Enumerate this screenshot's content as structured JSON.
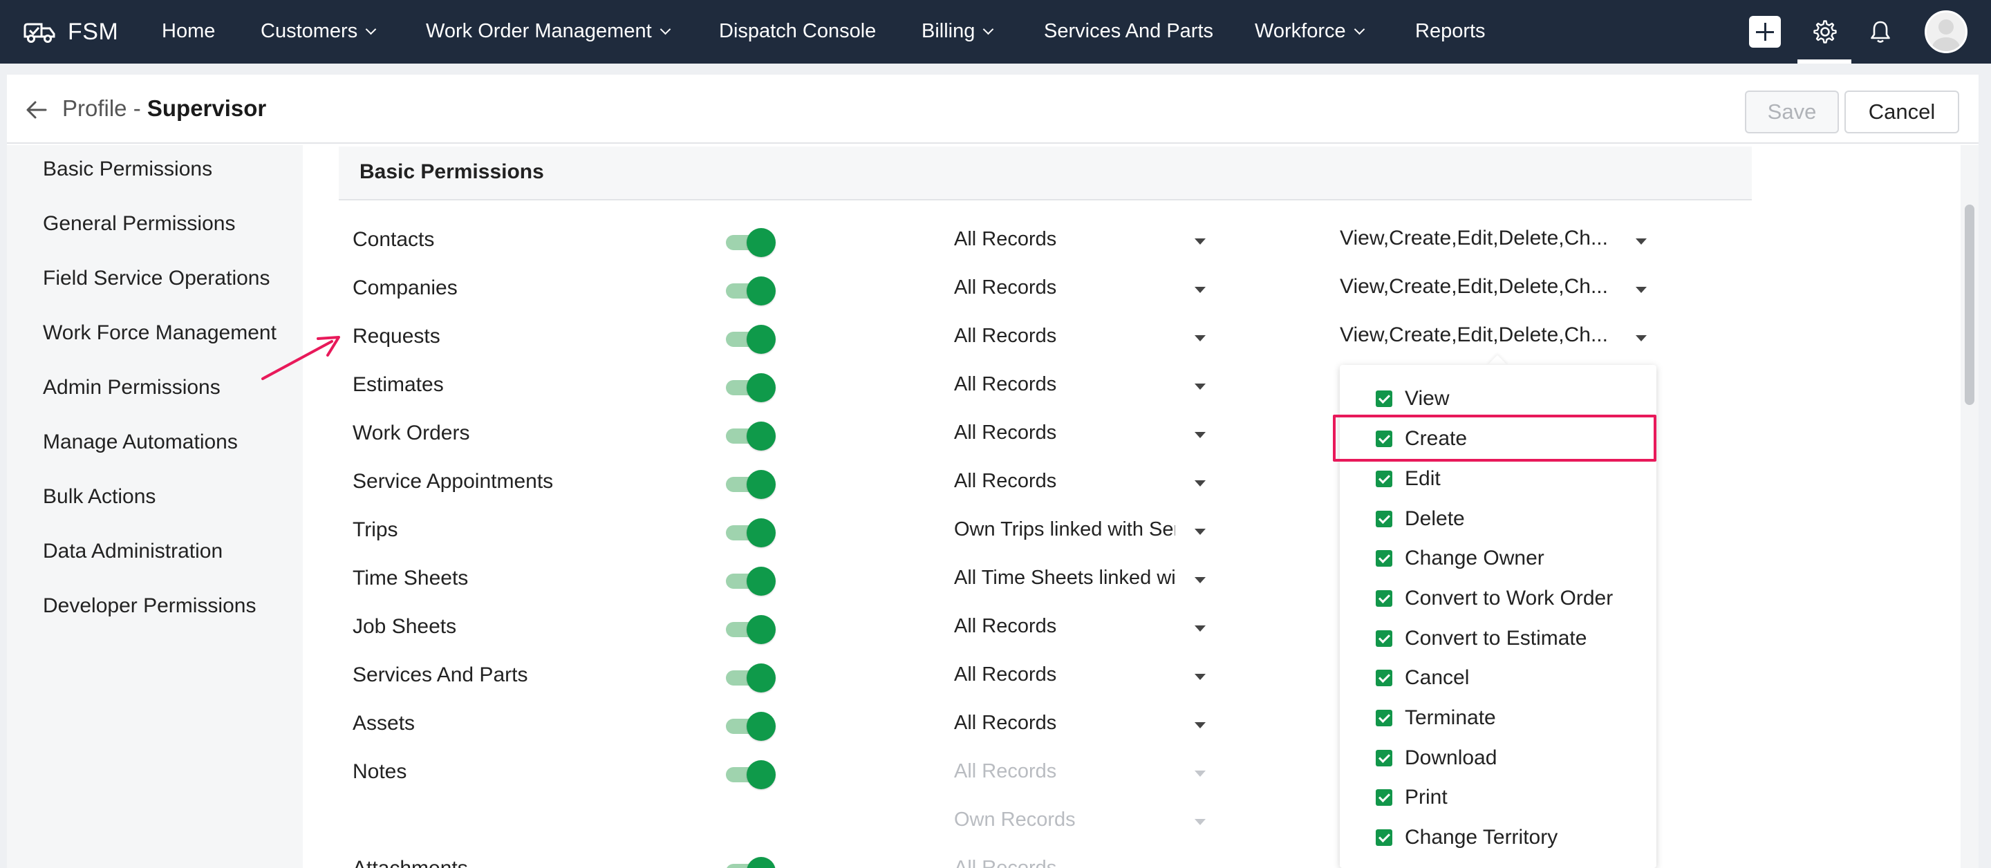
{
  "app": {
    "name": "FSM"
  },
  "nav": {
    "items": [
      {
        "label": "Home",
        "dropdown": false
      },
      {
        "label": "Customers",
        "dropdown": true
      },
      {
        "label": "Work Order Management",
        "dropdown": true
      },
      {
        "label": "Dispatch Console",
        "dropdown": false
      },
      {
        "label": "Billing",
        "dropdown": true
      },
      {
        "label": "Services And Parts",
        "dropdown": false
      },
      {
        "label": "Workforce",
        "dropdown": true
      },
      {
        "label": "Reports",
        "dropdown": false
      }
    ],
    "icons": [
      "plus-icon",
      "gear-icon",
      "bell-icon",
      "user-avatar"
    ]
  },
  "header": {
    "prefix": "Profile - ",
    "title": "Supervisor",
    "save_label": "Save",
    "cancel_label": "Cancel"
  },
  "sidebar": {
    "items": [
      "Basic Permissions",
      "General Permissions",
      "Field Service Operations",
      "Work Force Management",
      "Admin Permissions",
      "Manage Automations",
      "Bulk Actions",
      "Data Administration",
      "Developer Permissions"
    ]
  },
  "section": {
    "title": "Basic Permissions"
  },
  "rows": [
    {
      "label": "Contacts",
      "enabled": true,
      "scope": "All Records",
      "permissions": "View,Create,Edit,Delete,Ch..."
    },
    {
      "label": "Companies",
      "enabled": true,
      "scope": "All Records",
      "permissions": "View,Create,Edit,Delete,Ch..."
    },
    {
      "label": "Requests",
      "enabled": true,
      "scope": "All Records",
      "permissions": "View,Create,Edit,Delete,Ch..."
    },
    {
      "label": "Estimates",
      "enabled": true,
      "scope": "All Records",
      "permissions": ""
    },
    {
      "label": "Work Orders",
      "enabled": true,
      "scope": "All Records",
      "permissions": ""
    },
    {
      "label": "Service Appointments",
      "enabled": true,
      "scope": "All Records",
      "permissions": ""
    },
    {
      "label": "Trips",
      "enabled": true,
      "scope": "Own Trips linked with Ser",
      "permissions": ""
    },
    {
      "label": "Time Sheets",
      "enabled": true,
      "scope": "All Time Sheets linked wi",
      "permissions": ""
    },
    {
      "label": "Job Sheets",
      "enabled": true,
      "scope": "All Records",
      "permissions": ""
    },
    {
      "label": "Services And Parts",
      "enabled": true,
      "scope": "All Records",
      "permissions": ""
    },
    {
      "label": "Assets",
      "enabled": true,
      "scope": "All Records",
      "permissions": ""
    },
    {
      "label": "Notes",
      "enabled": true,
      "scope": "All Records",
      "scope_disabled": true,
      "permissions": ""
    },
    {
      "label": "",
      "enabled": false,
      "scope": "Own Records",
      "scope_disabled": true,
      "permissions": ""
    },
    {
      "label": "Attachments",
      "enabled": true,
      "scope": "All Records",
      "scope_disabled": true,
      "permissions": ""
    }
  ],
  "dropdown": {
    "options": [
      {
        "label": "View",
        "checked": true
      },
      {
        "label": "Create",
        "checked": true,
        "highlighted": true
      },
      {
        "label": "Edit",
        "checked": true
      },
      {
        "label": "Delete",
        "checked": true
      },
      {
        "label": "Change Owner",
        "checked": true
      },
      {
        "label": "Convert to Work Order",
        "checked": true
      },
      {
        "label": "Convert to Estimate",
        "checked": true
      },
      {
        "label": "Cancel",
        "checked": true
      },
      {
        "label": "Terminate",
        "checked": true
      },
      {
        "label": "Download",
        "checked": true
      },
      {
        "label": "Print",
        "checked": true
      },
      {
        "label": "Change Territory",
        "checked": true
      }
    ]
  },
  "colors": {
    "nav_bg": "#1f2b3d",
    "toggle_on": "#0f9a4a",
    "checkbox": "#12964a",
    "highlight": "#e8195a"
  }
}
